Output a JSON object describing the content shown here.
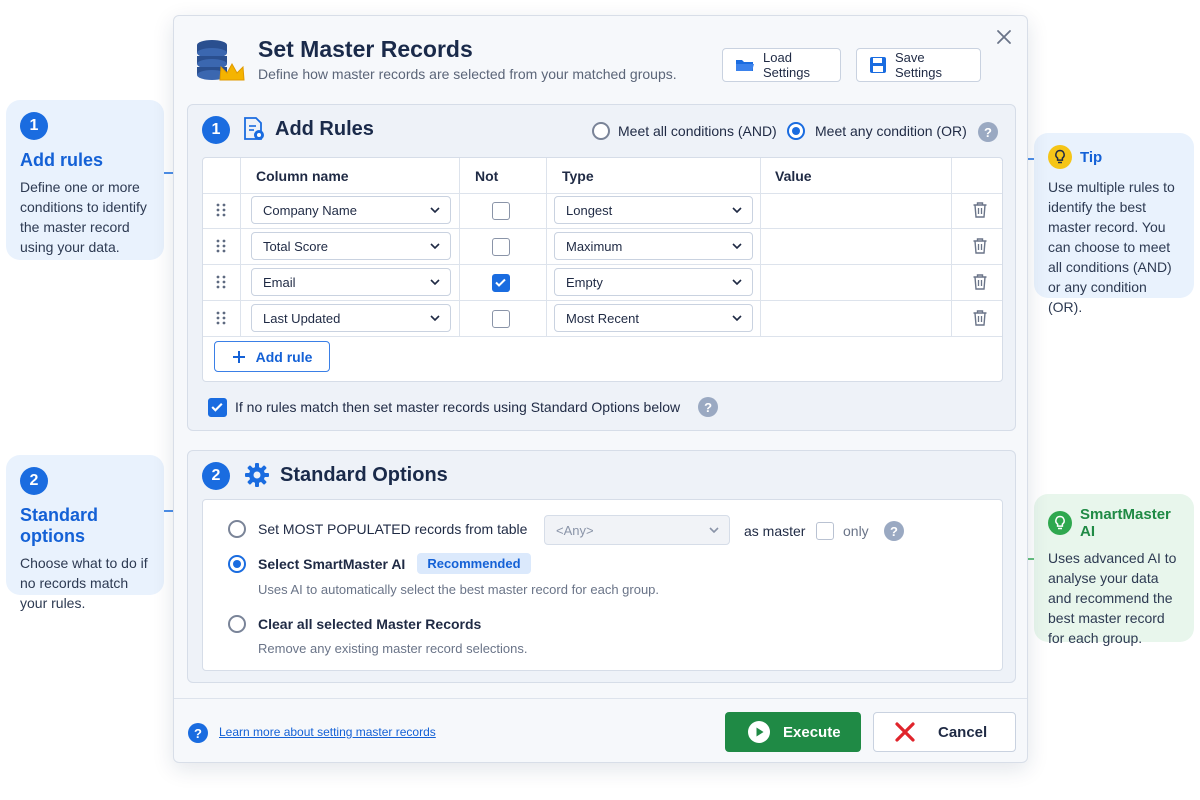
{
  "dialog": {
    "title": "Set Master Records",
    "subtitle": "Define how master records are selected from your matched groups.",
    "load_settings": "Load Settings",
    "save_settings": "Save Settings"
  },
  "add_rules": {
    "number": "1",
    "title": "Add Rules",
    "match_all_label": "Meet all conditions (AND)",
    "match_any_label": "Meet any condition (OR)",
    "match_mode": "any",
    "columns": [
      "Column name",
      "Not",
      "Type",
      "Value"
    ],
    "rows": [
      {
        "column": "Company Name",
        "not": false,
        "type": "Longest",
        "value": ""
      },
      {
        "column": "Total Score",
        "not": false,
        "type": "Maximum",
        "value": ""
      },
      {
        "column": "Email",
        "not": true,
        "type": "Empty",
        "value": ""
      },
      {
        "column": "Last Updated",
        "not": false,
        "type": "Most Recent",
        "value": ""
      }
    ],
    "add_rule_label": "Add rule",
    "fallback_checked": true,
    "fallback_label": "If no rules match then set master records using Standard Options below"
  },
  "standard_options": {
    "number": "2",
    "title": "Standard Options",
    "most_populated_label": "Set MOST POPULATED records from table",
    "table_select_value": "<Any>",
    "as_master_label": "as master",
    "only_label": "only",
    "smartmaster_label": "Select SmartMaster AI",
    "recommended_badge": "Recommended",
    "smartmaster_desc": "Uses AI to automatically select the best master record for each group.",
    "clear_label": "Clear all selected Master Records",
    "clear_desc": "Remove any existing master record selections.",
    "selected": "smartmaster"
  },
  "footer": {
    "help_link": "Learn more about setting master records",
    "execute": "Execute",
    "cancel": "Cancel"
  },
  "callouts": {
    "add_rules": {
      "number": "1",
      "title": "Add rules",
      "text": "Define one or more conditions to identify the master record using your data."
    },
    "standard": {
      "number": "2",
      "title": "Standard options",
      "text": "Choose what to do if no records match your rules."
    },
    "tip": {
      "title": "Tip",
      "text": "Use multiple rules to identify the best master record. You can choose to meet all conditions (AND) or any condition (OR)."
    },
    "smartmaster": {
      "title": "SmartMaster AI",
      "text": "Uses advanced AI to analyse your data and recommend the best master record for each group."
    }
  },
  "colors": {
    "accent": "#1a6ce0",
    "execute": "#1f8a45",
    "cancel_x": "#e0242b",
    "tip_bulb": "#f5c518",
    "ai_bulb": "#2fa84f"
  }
}
